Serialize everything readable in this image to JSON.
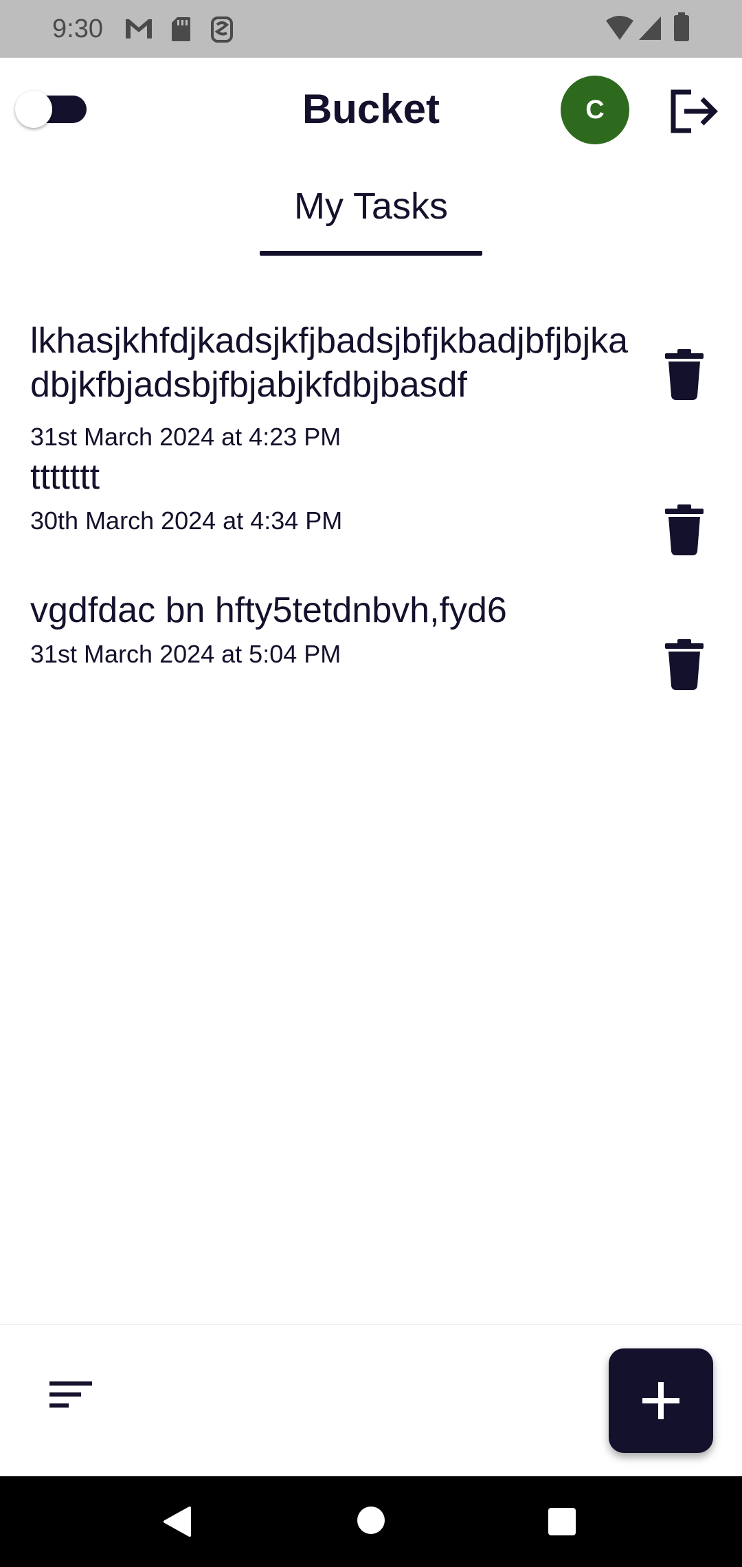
{
  "status_bar": {
    "time": "9:30",
    "icons_left": [
      "gmail-icon",
      "sd-card-icon",
      "assistant-icon"
    ],
    "icons_right": [
      "wifi-icon",
      "signal-icon",
      "battery-icon"
    ]
  },
  "header": {
    "title": "Bucket",
    "avatar_letter": "C",
    "avatar_color": "#2e6a1e",
    "toggle_state": "off"
  },
  "tabs": [
    {
      "label": "My Tasks",
      "active": true
    }
  ],
  "tasks": [
    {
      "title": "lkhasjkhfdjkadsjkfjbadsjbfjkbadjbfjbjkadbjkfbjadsbjfbjabjkfdbjbasdf",
      "date": "31st March 2024 at 4:23 PM"
    },
    {
      "title": "ttttttt",
      "date": "30th March 2024 at 4:34 PM"
    },
    {
      "title": "vgdfdac bn hfty5tetdnbvh,fyd6",
      "date": "31st March 2024 at 5:04 PM"
    }
  ],
  "bottom": {
    "sort_icon": "sort-icon",
    "fab_icon": "plus-icon"
  },
  "colors": {
    "primary": "#13112b",
    "background": "#ffffff",
    "status_bar": "#bdbdbd"
  }
}
